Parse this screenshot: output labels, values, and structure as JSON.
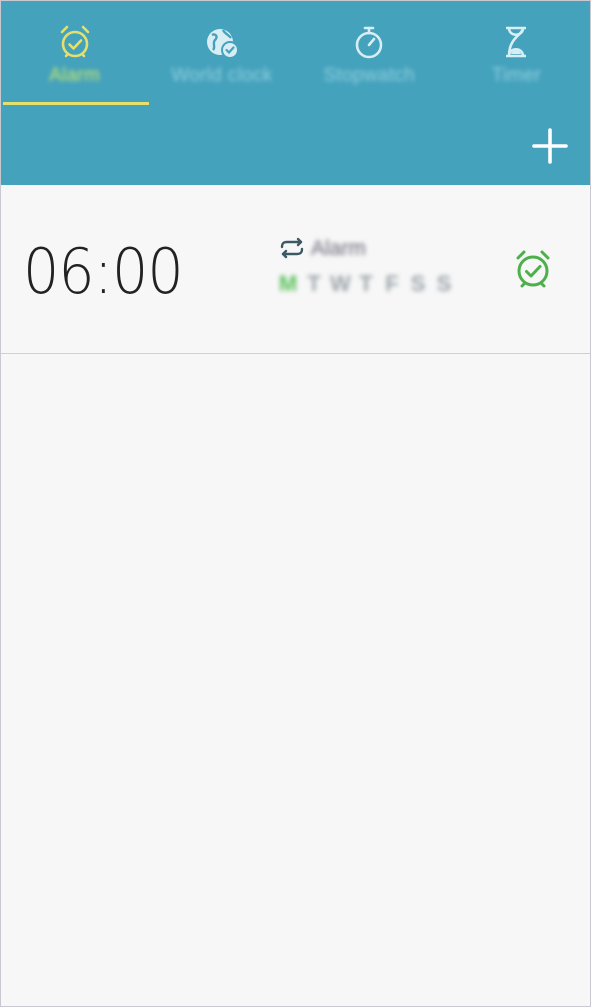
{
  "tabs": [
    {
      "label": "Alarm",
      "icon": "alarm-clock-icon",
      "active": true
    },
    {
      "label": "World clock",
      "icon": "globe-icon",
      "active": false
    },
    {
      "label": "Stopwatch",
      "icon": "stopwatch-icon",
      "active": false
    },
    {
      "label": "Timer",
      "icon": "hourglass-icon",
      "active": false
    }
  ],
  "colors": {
    "header": "#45a2bd",
    "active_tab": "#e5e06b",
    "alarm_on": "#4db04a",
    "background": "#f7f7f7"
  },
  "alarm": {
    "time": "06:00",
    "name": "Alarm",
    "days": [
      "M",
      "T",
      "W",
      "T",
      "F",
      "S",
      "S"
    ],
    "active_days": [
      0
    ],
    "enabled": true
  }
}
